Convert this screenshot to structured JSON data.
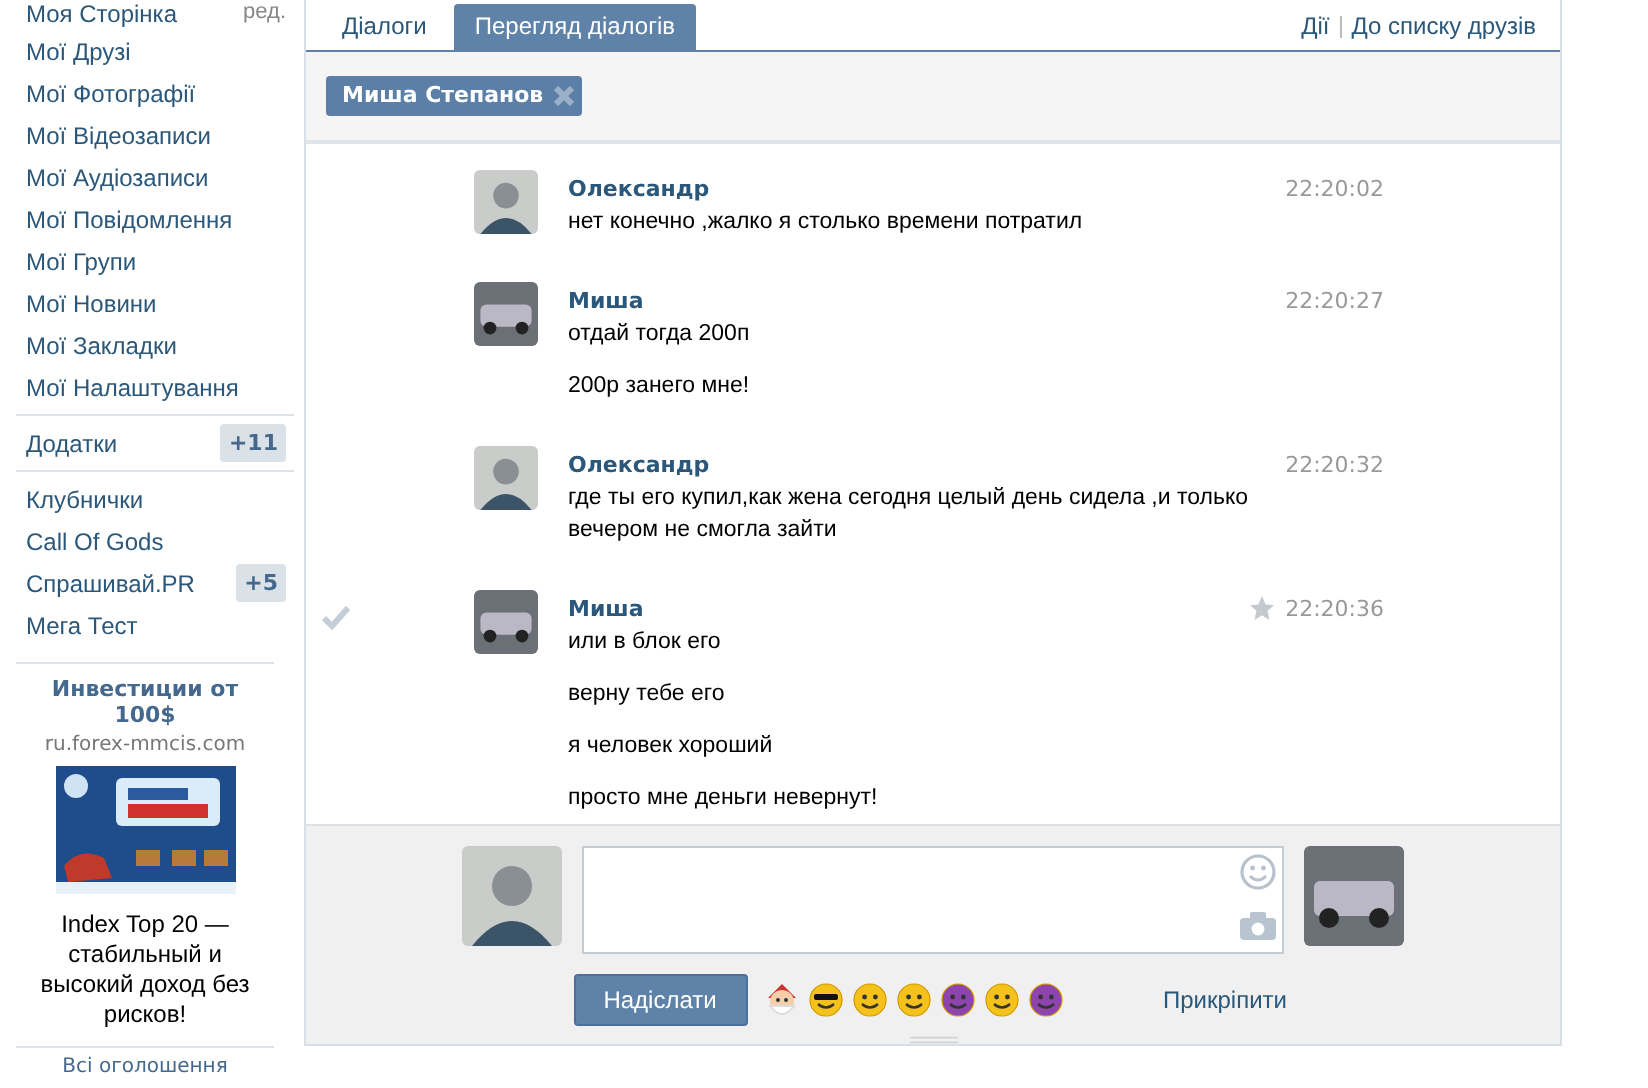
{
  "sidebar": {
    "items": [
      {
        "label": "Моя Сторінка",
        "extra": "ред."
      },
      {
        "label": "Мої Друзі"
      },
      {
        "label": "Мої Фотографії"
      },
      {
        "label": "Мої Відеозаписи"
      },
      {
        "label": "Мої Аудіозаписи"
      },
      {
        "label": "Мої Повідомлення"
      },
      {
        "label": "Мої Групи"
      },
      {
        "label": "Мої Новини"
      },
      {
        "label": "Мої Закладки"
      },
      {
        "label": "Мої Налаштування"
      }
    ],
    "apps_header": {
      "label": "Додатки",
      "badge": "+11"
    },
    "apps": [
      {
        "label": "Клубнички"
      },
      {
        "label": "Call Of Gods"
      },
      {
        "label": "Спрашивай.PR",
        "badge": "+5"
      },
      {
        "label": "Мега Тест"
      }
    ],
    "ad": {
      "title": "Инвестиции от 100$",
      "domain": "ru.forex-mmcis.com",
      "text": "Index Top 20 — стабильный и высокий доход без рисков!"
    },
    "all_ads_link": "Всі оголошення"
  },
  "tabs": [
    {
      "label": "Діалоги",
      "selected": false
    },
    {
      "label": "Перегляд діалогів",
      "selected": true
    }
  ],
  "top_links": [
    "Дії",
    "До списку друзів"
  ],
  "recipient": {
    "name": "Миша Степанов"
  },
  "messages": [
    {
      "author": "Олександр",
      "kind": "person",
      "time": "22:20:02",
      "hovered": false,
      "texts": [
        "нет конечно ,жалко я столько времени потратил"
      ]
    },
    {
      "author": "Миша",
      "kind": "car",
      "time": "22:20:27",
      "hovered": false,
      "texts": [
        "отдай тогда 200п",
        "200р занего мне!"
      ]
    },
    {
      "author": "Олександр",
      "kind": "person",
      "time": "22:20:32",
      "hovered": false,
      "texts": [
        "где ты его купил,как жена сегодня целый день сидела ,и только вечером не смогла зайти"
      ]
    },
    {
      "author": "Миша",
      "kind": "car",
      "time": "22:20:36",
      "hovered": true,
      "texts": [
        "или в блок его",
        "верну тебе его",
        "я человек хороший",
        "просто мне деньги невернут!"
      ]
    }
  ],
  "compose": {
    "send": "Надіслати",
    "attach": "Прикріпити"
  }
}
